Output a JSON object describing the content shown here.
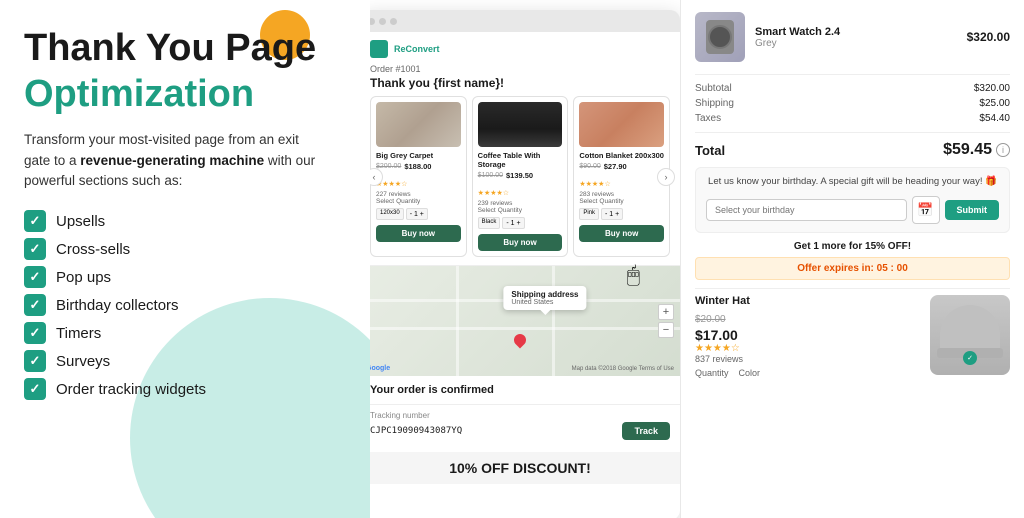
{
  "left": {
    "title_line1": "Thank You Page",
    "title_line2": "Optimization",
    "description_text": "Transform your most-visited page from an exit gate to a ",
    "description_bold": "revenue-generating machine",
    "description_suffix": " with our powerful sections such as:",
    "features": [
      {
        "id": "upsells",
        "label": "Upsells"
      },
      {
        "id": "cross-sells",
        "label": "Cross-sells"
      },
      {
        "id": "pop-ups",
        "label": "Pop ups"
      },
      {
        "id": "birthday-collectors",
        "label": "Birthday collectors"
      },
      {
        "id": "timers",
        "label": "Timers"
      },
      {
        "id": "surveys",
        "label": "Surveys"
      },
      {
        "id": "order-tracking",
        "label": "Order tracking widgets"
      }
    ]
  },
  "browser": {
    "order_number": "Order #1001",
    "thank_you": "Thank you {first name}!",
    "products": [
      {
        "id": "carpet",
        "name": "Big Grey Carpet",
        "price_old": "$200.00",
        "price_new": "$188.00",
        "stars": 4,
        "reviews": "227 reviews",
        "select_default": "120x30",
        "qty": "1"
      },
      {
        "id": "coffee-table",
        "name": "Coffee Table With Storage",
        "price_old": "$100.00",
        "price_new": "$139.50",
        "stars": 4,
        "reviews": "239 reviews",
        "select_default": "Black",
        "qty": "1"
      },
      {
        "id": "blanket",
        "name": "Cotton Blanket 200x300",
        "price_old": "$90.00",
        "price_new": "$27.90",
        "stars": 4,
        "reviews": "283 reviews",
        "select_default": "Pink",
        "qty": "1"
      }
    ],
    "map_tooltip_line1": "Shipping address",
    "map_tooltip_line2": "United States",
    "order_confirmed": "Your order is confirmed",
    "tracking_label": "Tracking number",
    "tracking_number": "CJPC19090943087YQ",
    "track_button": "Track",
    "discount_banner": "10% OFF DISCOUNT!"
  },
  "right": {
    "product_name": "Smart Watch 2.4",
    "product_variant": "Grey",
    "product_price": "$320.00",
    "subtotal_label": "Subtotal",
    "subtotal_value": "$320.00",
    "shipping_label": "Shipping",
    "shipping_value": "$25.00",
    "taxes_label": "Taxes",
    "taxes_value": "$54.40",
    "total_label": "Total",
    "total_value": "$59.45",
    "birthday_text": "Let us know your birthday. A special gift will be heading your way! 🎁",
    "birthday_placeholder": "Select your birthday",
    "birthday_submit": "Submit",
    "upsell_label": "Get 1 more for 15% OFF!",
    "offer_label": "Offer expires in: 05 : 00",
    "hat_name": "Winter Hat",
    "hat_price_old": "$20.00",
    "hat_price_new": "$17.00",
    "hat_stars": 4,
    "hat_reviews": "837 reviews",
    "hat_qty_label": "Quantity",
    "hat_color_label": "Color"
  }
}
